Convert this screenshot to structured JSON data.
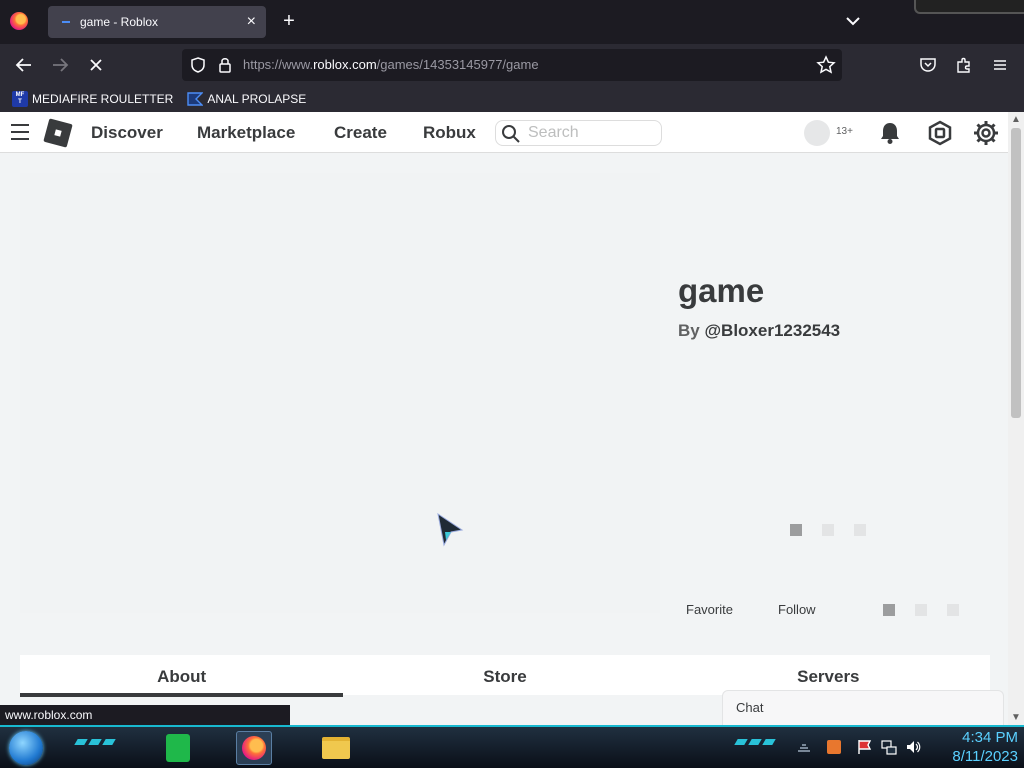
{
  "browser": {
    "tab_title": "game - Roblox",
    "new_tab_label": "+",
    "close_tab_label": "×",
    "url_prefix": "https://www.",
    "url_domain": "roblox.com",
    "url_path": "/games/14353145977/game",
    "status_link": "www.roblox.com"
  },
  "bookmarks": [
    {
      "label": "MEDIAFIRE ROULETTER",
      "icon": "mediafire-icon"
    },
    {
      "label": "ANAL PROLAPSE",
      "icon": "bookmark-folder-icon"
    }
  ],
  "roblox_header": {
    "nav": [
      "Discover",
      "Marketplace",
      "Create",
      "Robux"
    ],
    "search_placeholder": "Search",
    "age_badge": "13+"
  },
  "game": {
    "title": "game",
    "creator_prefix": "By",
    "creator": "@Bloxer1232543",
    "favorite_label": "Favorite",
    "follow_label": "Follow"
  },
  "tabs": [
    {
      "label": "About",
      "active": true
    },
    {
      "label": "Store",
      "active": false
    },
    {
      "label": "Servers",
      "active": false
    }
  ],
  "chat": {
    "label": "Chat"
  },
  "taskbar": {
    "time": "4:34 PM",
    "date": "8/11/2023"
  },
  "colors": {
    "accent": "#393b3d",
    "taskbar_accent": "#18b9d0",
    "clock": "#5ad0ff"
  }
}
